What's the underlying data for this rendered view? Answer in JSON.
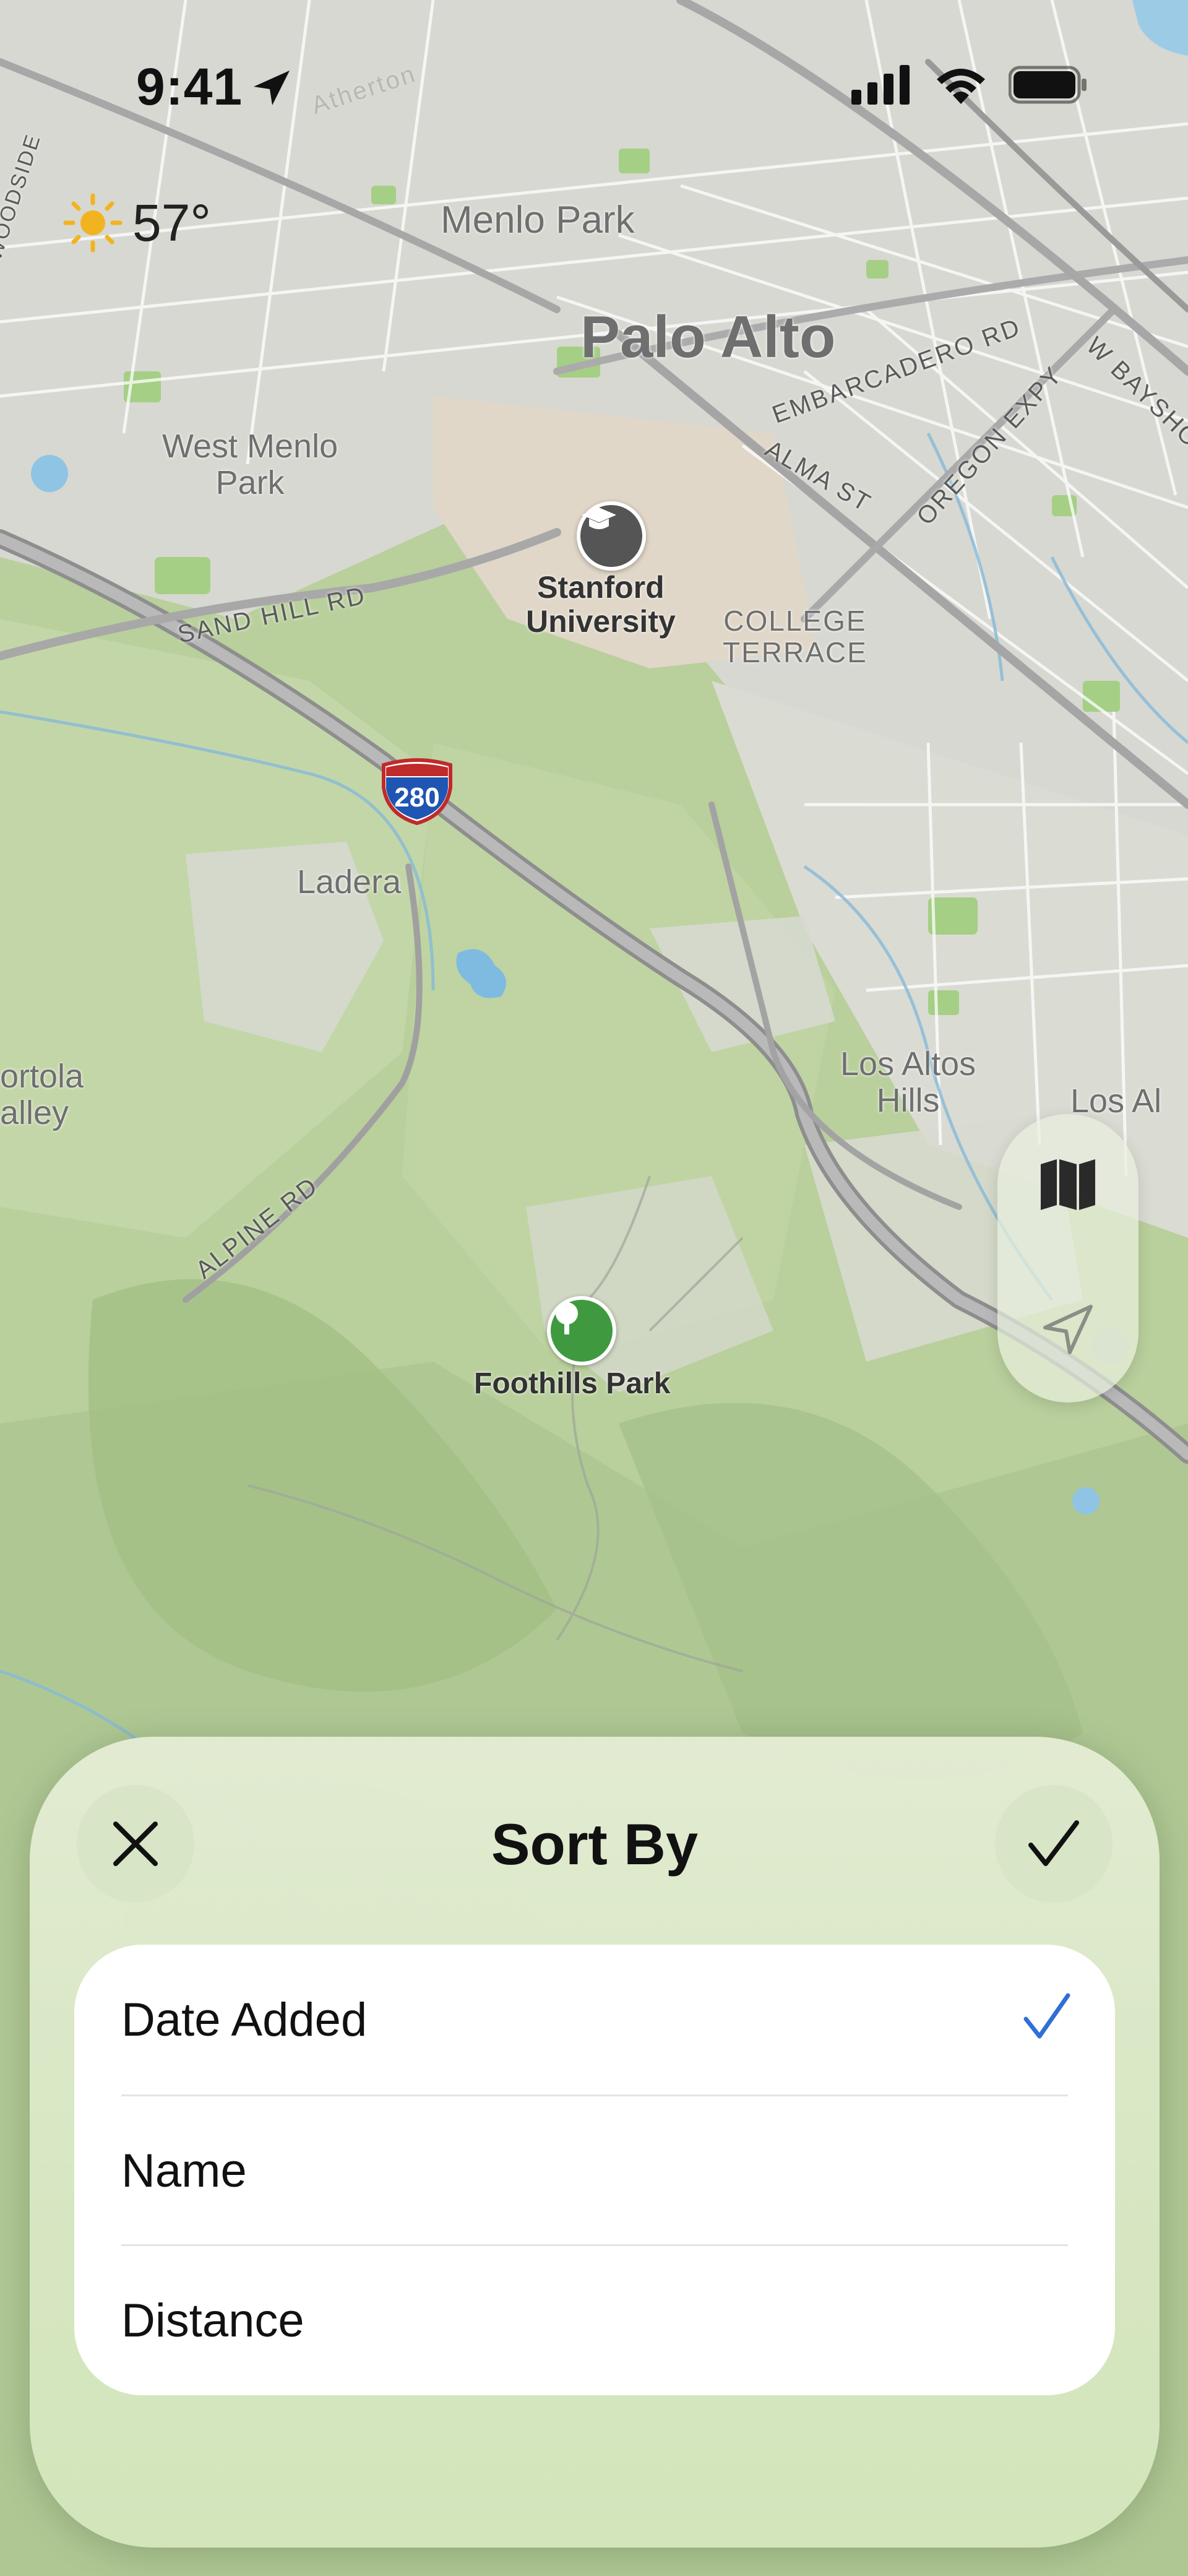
{
  "status_bar": {
    "time": "9:41",
    "icons": [
      "location-arrow-icon",
      "cellular-signal-icon",
      "wifi-icon",
      "battery-icon"
    ]
  },
  "weather": {
    "icon": "sun-icon",
    "temperature": "57°"
  },
  "map": {
    "places": [
      {
        "key": "menlo_park",
        "label": "Menlo Park"
      },
      {
        "key": "palo_alto",
        "label": "Palo Alto"
      },
      {
        "key": "west_menlo_park",
        "label": "West Menlo\nPark"
      },
      {
        "key": "stanford",
        "label": "Stanford\nUniversity"
      },
      {
        "key": "college_terrace",
        "label": "COLLEGE\nTERRACE"
      },
      {
        "key": "ladera",
        "label": "Ladera"
      },
      {
        "key": "portola_valley",
        "label": "ortola\nalley"
      },
      {
        "key": "los_altos_hills",
        "label": "Los Altos\nHills"
      },
      {
        "key": "los_altos",
        "label": "Los Al"
      },
      {
        "key": "foothills_park",
        "label": "Foothills Park"
      }
    ],
    "roads": {
      "woodside": "WOODSIDE",
      "sand_hill": "SAND HILL RD",
      "embarcadero": "EMBARCADERO RD",
      "alma": "ALMA ST",
      "oregon": "OREGON EXPY",
      "bayshore": "W BAYSHO",
      "alpine": "ALPINE RD",
      "faded_top": "Atherton"
    },
    "highway_shield": "280",
    "controls": {
      "map_mode_icon": "map-icon",
      "locate_icon": "location-arrow-outline-icon"
    }
  },
  "sheet": {
    "title": "Sort By",
    "close_icon": "close-icon",
    "done_icon": "checkmark-icon",
    "options": [
      {
        "label": "Date Added",
        "selected": true
      },
      {
        "label": "Name",
        "selected": false
      },
      {
        "label": "Distance",
        "selected": false
      }
    ],
    "accent_color": "#2f6fd6"
  }
}
